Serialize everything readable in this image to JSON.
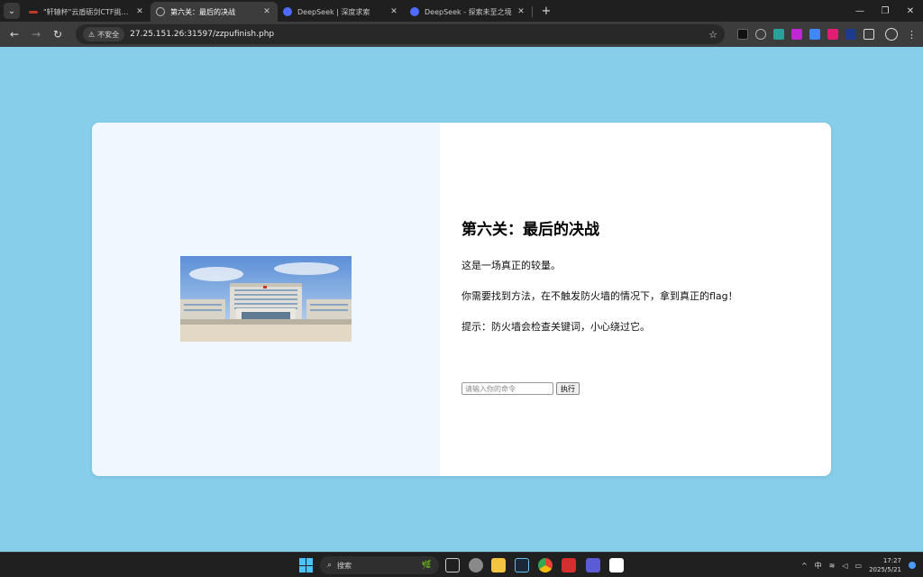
{
  "browser": {
    "tabs": [
      {
        "label": "\"轩辕杯\"云盾砺剑CTF挑战赛",
        "active": false,
        "favicon_color": "#c0392b"
      },
      {
        "label": "第六关：最后的决战",
        "active": true,
        "favicon_color": "#9aa0a6"
      },
      {
        "label": "DeepSeek | 深度求索",
        "active": false,
        "favicon_color": "#4d6bfe"
      },
      {
        "label": "DeepSeek - 探索未至之境",
        "active": false,
        "favicon_color": "#4d6bfe"
      }
    ],
    "security_label": "不安全",
    "url": "27.25.151.26:31597/zzpufinish.php"
  },
  "page": {
    "title": "第六关：最后的决战",
    "paragraphs": [
      "这是一场真正的较量。",
      "你需要找到方法，在不触发防火墙的情况下，拿到真正的flag！",
      "提示：防火墙会检查关键词，小心绕过它。"
    ],
    "command_placeholder": "请输入你的命令",
    "execute_label": "执行"
  },
  "taskbar": {
    "search_label": "搜索",
    "ime_label": "中",
    "time": "17:27",
    "date": "2025/5/21"
  },
  "colors": {
    "page_background": "#87ceeb",
    "left_panel": "#f0f8ff",
    "card": "#ffffff"
  }
}
